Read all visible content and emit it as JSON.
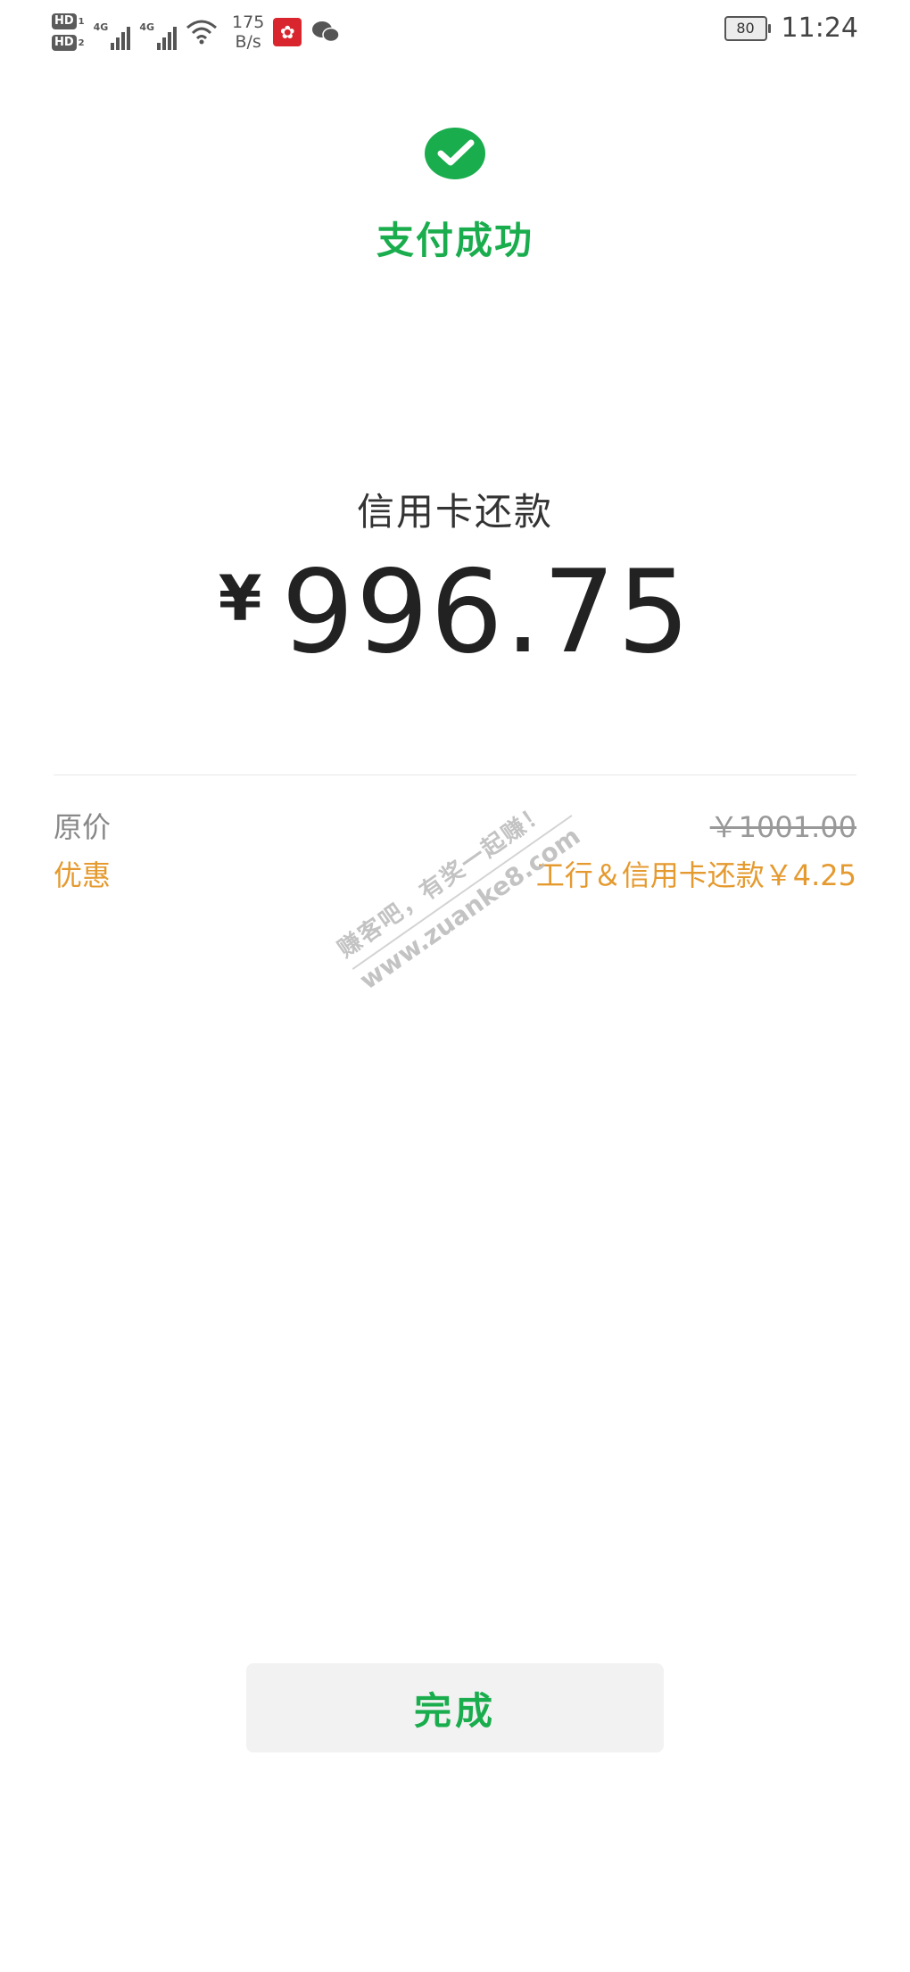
{
  "status_bar": {
    "hd1_label": "HD",
    "hd1_sub": "1",
    "hd2_label": "HD",
    "hd2_sub": "2",
    "signal1_label": "4G",
    "signal2_label": "4G",
    "speed_value": "175",
    "speed_unit": "B/s",
    "battery_level": "80",
    "time": "11:24"
  },
  "header": {
    "title": "支付成功"
  },
  "payment": {
    "merchant": "信用卡还款",
    "currency_symbol": "¥",
    "amount": "996.75"
  },
  "details": {
    "original_label": "原价",
    "original_value": "￥1001.00",
    "discount_label": "优惠",
    "discount_value": "工行＆信用卡还款￥4.25"
  },
  "watermark": {
    "line1": "赚客吧，有奖一起赚！",
    "line2": "www.zuanke8.com"
  },
  "actions": {
    "done_label": "完成"
  },
  "colors": {
    "brand_green": "#1aad4d",
    "discount_orange": "#e59a2f",
    "text_gray": "#888888"
  }
}
